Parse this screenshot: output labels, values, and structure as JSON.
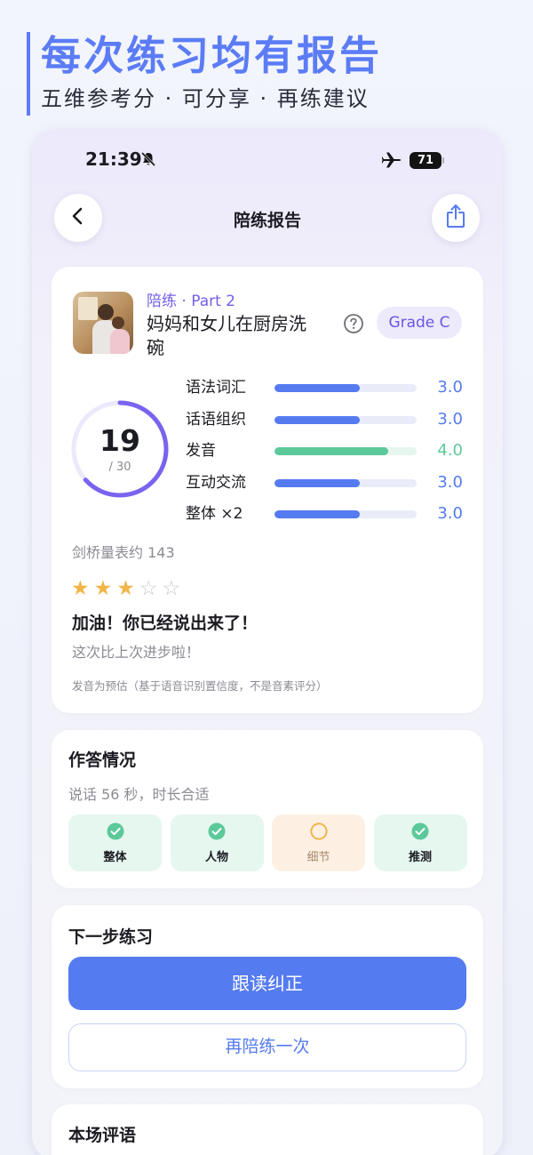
{
  "promo": {
    "title": "每次练习均有报告",
    "subtitle": "五维参考分 ·  可分享 ·  再练建议"
  },
  "status_bar": {
    "time": "21:39",
    "battery": "71",
    "icons": [
      "bell-slash-icon",
      "airplane-icon",
      "battery-icon"
    ]
  },
  "nav": {
    "title": "陪练报告",
    "back_icon": "chevron-left-icon",
    "share_icon": "share-icon"
  },
  "report": {
    "kicker": "陪练 · Part 2",
    "task_title": "妈妈和女儿在厨房洗碗",
    "help_icon": "question-circle-icon",
    "grade": "Grade C",
    "score": "19",
    "score_total": "/ 30",
    "score_fraction": 0.633,
    "dimensions": [
      {
        "label": "语法词汇",
        "value": "3.0",
        "fraction": 0.6,
        "color": "#557bf0"
      },
      {
        "label": "话语组织",
        "value": "3.0",
        "fraction": 0.6,
        "color": "#557bf0"
      },
      {
        "label": "发音",
        "value": "4.0",
        "fraction": 0.8,
        "color": "#5cc99a"
      },
      {
        "label": "互动交流",
        "value": "3.0",
        "fraction": 0.6,
        "color": "#557bf0"
      },
      {
        "label": "整体 ×2",
        "value": "3.0",
        "fraction": 0.6,
        "color": "#557bf0"
      }
    ],
    "cambridge": "剑桥量表约 143",
    "stars": {
      "filled": 3,
      "total": 5
    },
    "cheer": "加油！你已经说出来了！",
    "progress_note": "这次比上次进步啦！",
    "disclaimer": "发音为预估（基于语音识别置信度，不是音素评分）"
  },
  "answer": {
    "title": "作答情况",
    "duration": "说话 56 秒，时长合适",
    "chips": [
      {
        "label": "整体",
        "status": "ok"
      },
      {
        "label": "人物",
        "status": "ok"
      },
      {
        "label": "细节",
        "status": "warn"
      },
      {
        "label": "推测",
        "status": "ok"
      }
    ]
  },
  "next": {
    "title": "下一步练习",
    "primary": "跟读纠正",
    "secondary": "再陪练一次"
  },
  "comment": {
    "title": "本场评语"
  },
  "colors": {
    "accent": "#557bf0",
    "purple": "#7260ea",
    "green": "#5cc99a",
    "star": "#f1b549",
    "warn": "#f1b549"
  }
}
